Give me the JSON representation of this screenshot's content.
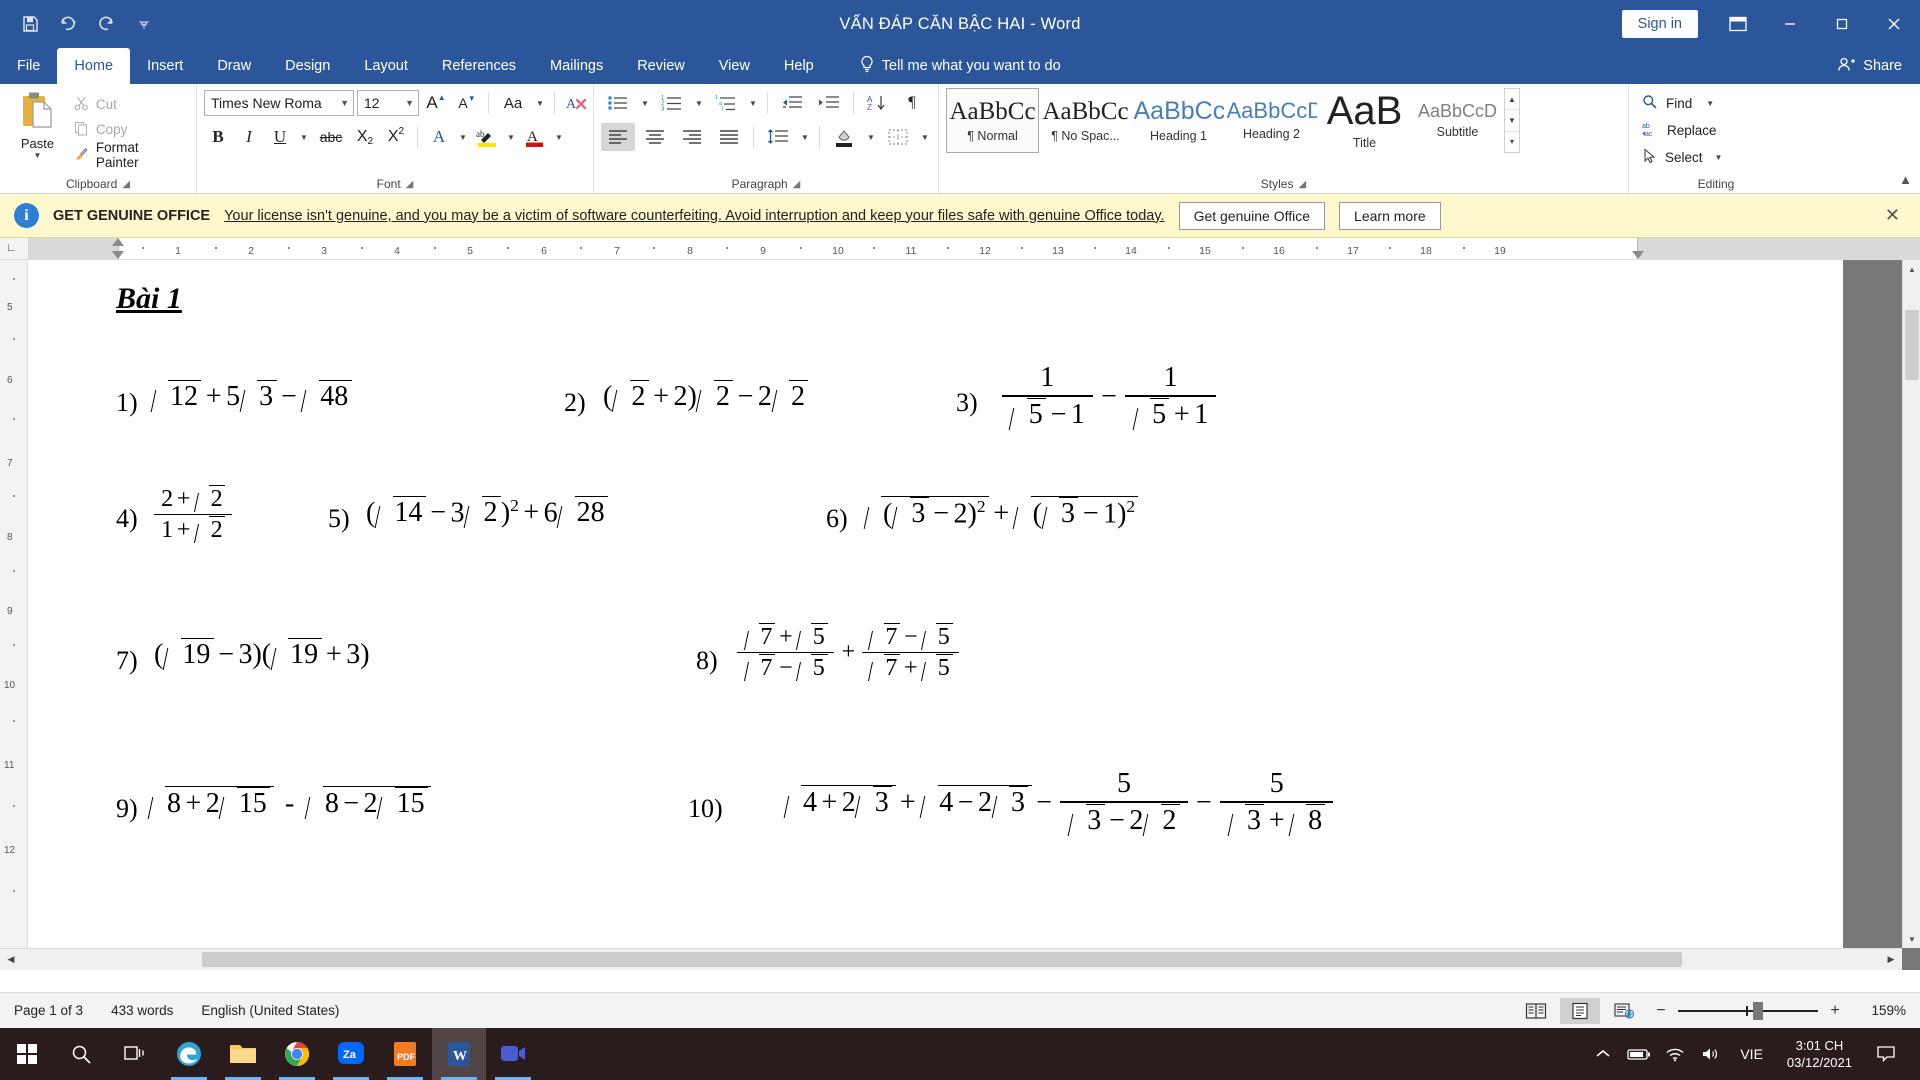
{
  "window": {
    "title": "VẤN ĐÁP CĂN BẬC HAI  -  Word",
    "signin_label": "Sign in",
    "minimize": "─",
    "maximize": "☐",
    "close": "✕"
  },
  "quick_access": [
    "save-icon",
    "undo-icon",
    "redo-icon",
    "customize-qat-icon"
  ],
  "tabs": [
    {
      "label": "File",
      "active": false
    },
    {
      "label": "Home",
      "active": true
    },
    {
      "label": "Insert",
      "active": false
    },
    {
      "label": "Draw",
      "active": false
    },
    {
      "label": "Design",
      "active": false
    },
    {
      "label": "Layout",
      "active": false
    },
    {
      "label": "References",
      "active": false
    },
    {
      "label": "Mailings",
      "active": false
    },
    {
      "label": "Review",
      "active": false
    },
    {
      "label": "View",
      "active": false
    },
    {
      "label": "Help",
      "active": false
    }
  ],
  "tell_me": "Tell me what you want to do",
  "share": "Share",
  "ribbon": {
    "clipboard": {
      "label": "Clipboard",
      "paste": "Paste",
      "cut": "Cut",
      "copy": "Copy",
      "format_painter": "Format Painter"
    },
    "font": {
      "label": "Font",
      "family": "Times New Roma",
      "size": "12",
      "grow": "A",
      "shrink": "A",
      "change_case": "Aa",
      "clear_formatting": "A",
      "bold": "B",
      "italic": "I",
      "underline": "U",
      "strikethrough": "abc",
      "subscript": "X",
      "superscript": "X",
      "text_effects": "A",
      "highlight": "ab",
      "font_color": "A"
    },
    "paragraph": {
      "label": "Paragraph"
    },
    "styles": {
      "label": "Styles",
      "items": [
        {
          "preview": "AaBbCc",
          "name": "¶ Normal",
          "kind": "serif",
          "active": true
        },
        {
          "preview": "AaBbCc",
          "name": "¶ No Spac...",
          "kind": "serif",
          "active": false
        },
        {
          "preview": "AaBbCc",
          "name": "Heading 1",
          "kind": "blue",
          "active": false
        },
        {
          "preview": "AaBbCcD",
          "name": "Heading 2",
          "kind": "blue",
          "active": false
        },
        {
          "preview": "AaB",
          "name": "Title",
          "kind": "big",
          "active": false
        },
        {
          "preview": "AaBbCcD",
          "name": "Subtitle",
          "kind": "small",
          "active": false
        }
      ]
    },
    "editing": {
      "label": "Editing",
      "find": "Find",
      "replace": "Replace",
      "select": "Select"
    }
  },
  "notice": {
    "title": "GET GENUINE OFFICE",
    "message": "Your license isn't genuine, and you may be a victim of software counterfeiting. Avoid interruption and keep your files safe with genuine Office today.",
    "primary_button": "Get genuine Office",
    "secondary_button": "Learn more",
    "close": "✕"
  },
  "ruler": {
    "left_label": "1",
    "numbers": [
      "1",
      "2",
      "3",
      "4",
      "5",
      "6",
      "7",
      "8",
      "9",
      "10",
      "11",
      "12",
      "13",
      "14",
      "15",
      "16",
      "17",
      "18",
      "19"
    ],
    "vertical_labels": [
      "5",
      "6",
      "7",
      "8",
      "9",
      "10",
      "11",
      "12"
    ]
  },
  "document": {
    "heading": "Bài 1",
    "problems": [
      {
        "num": "1)",
        "expr_id": "p1"
      },
      {
        "num": "2)",
        "expr_id": "p2"
      },
      {
        "num": "3)",
        "expr_id": "p3"
      },
      {
        "num": "4)",
        "expr_id": "p4"
      },
      {
        "num": "5)",
        "expr_id": "p5"
      },
      {
        "num": "6)",
        "expr_id": "p6"
      },
      {
        "num": "7)",
        "expr_id": "p7"
      },
      {
        "num": "8)",
        "expr_id": "p8"
      },
      {
        "num": "9)",
        "expr_id": "p9"
      },
      {
        "num": "10)",
        "expr_id": "p10"
      }
    ],
    "math": {
      "p1": "√12 + 5√3 − √48",
      "p2": "(√2 + 2)√2 − 2√2",
      "p3": "1/(√5 − 1) − 1/(√5 + 1)",
      "p4": "(2 + √2)/(1 + √2)",
      "p5": "(√14 − 3√2)² + 6√28",
      "p6": "√((√3 − 2)²) + √((√3 − 1)²)",
      "p7": "(√19 − 3)(√19 + 3)",
      "p8": "(√7 + √5)/(√7 − √5) + (√7 − √5)/(√7 + √5)",
      "p9": "√(8 + 2√15) - √(8 − 2√15)",
      "p10": "√(4 + 2√3) + √(4 − 2√3) − 5/(√3 − 2√2) − 5/(√3 + √8)"
    }
  },
  "status": {
    "page": "Page 1 of 3",
    "words": "433 words",
    "language": "English (United States)",
    "zoom": "159%",
    "zoom_out": "−",
    "zoom_in": "+"
  },
  "taskbar": {
    "start": "start-icon",
    "search": "search-icon",
    "task_view": "task-view-icon",
    "apps": [
      {
        "name": "microsoft-edge",
        "color": "#2aa5d6"
      },
      {
        "name": "file-explorer",
        "color": "#ffc552"
      },
      {
        "name": "google-chrome",
        "color": "#ffffff"
      },
      {
        "name": "zalo",
        "color": "#0068ff"
      },
      {
        "name": "pdf-reader",
        "color": "#f07b22"
      },
      {
        "name": "microsoft-word",
        "color": "#2b579a"
      },
      {
        "name": "video-call",
        "color": "#4a5bd4"
      }
    ],
    "tray": {
      "show_hidden": "chevron-up-icon",
      "battery": "battery-icon",
      "wifi": "wifi-icon",
      "volume": "volume-icon",
      "language": "VIE",
      "time": "3:01 CH",
      "date": "03/12/2021",
      "action_center": "action-center-icon"
    }
  },
  "colors": {
    "word_blue": "#2b579a",
    "notice_bg": "#fff8cc",
    "accent": "#4a7ebb"
  }
}
